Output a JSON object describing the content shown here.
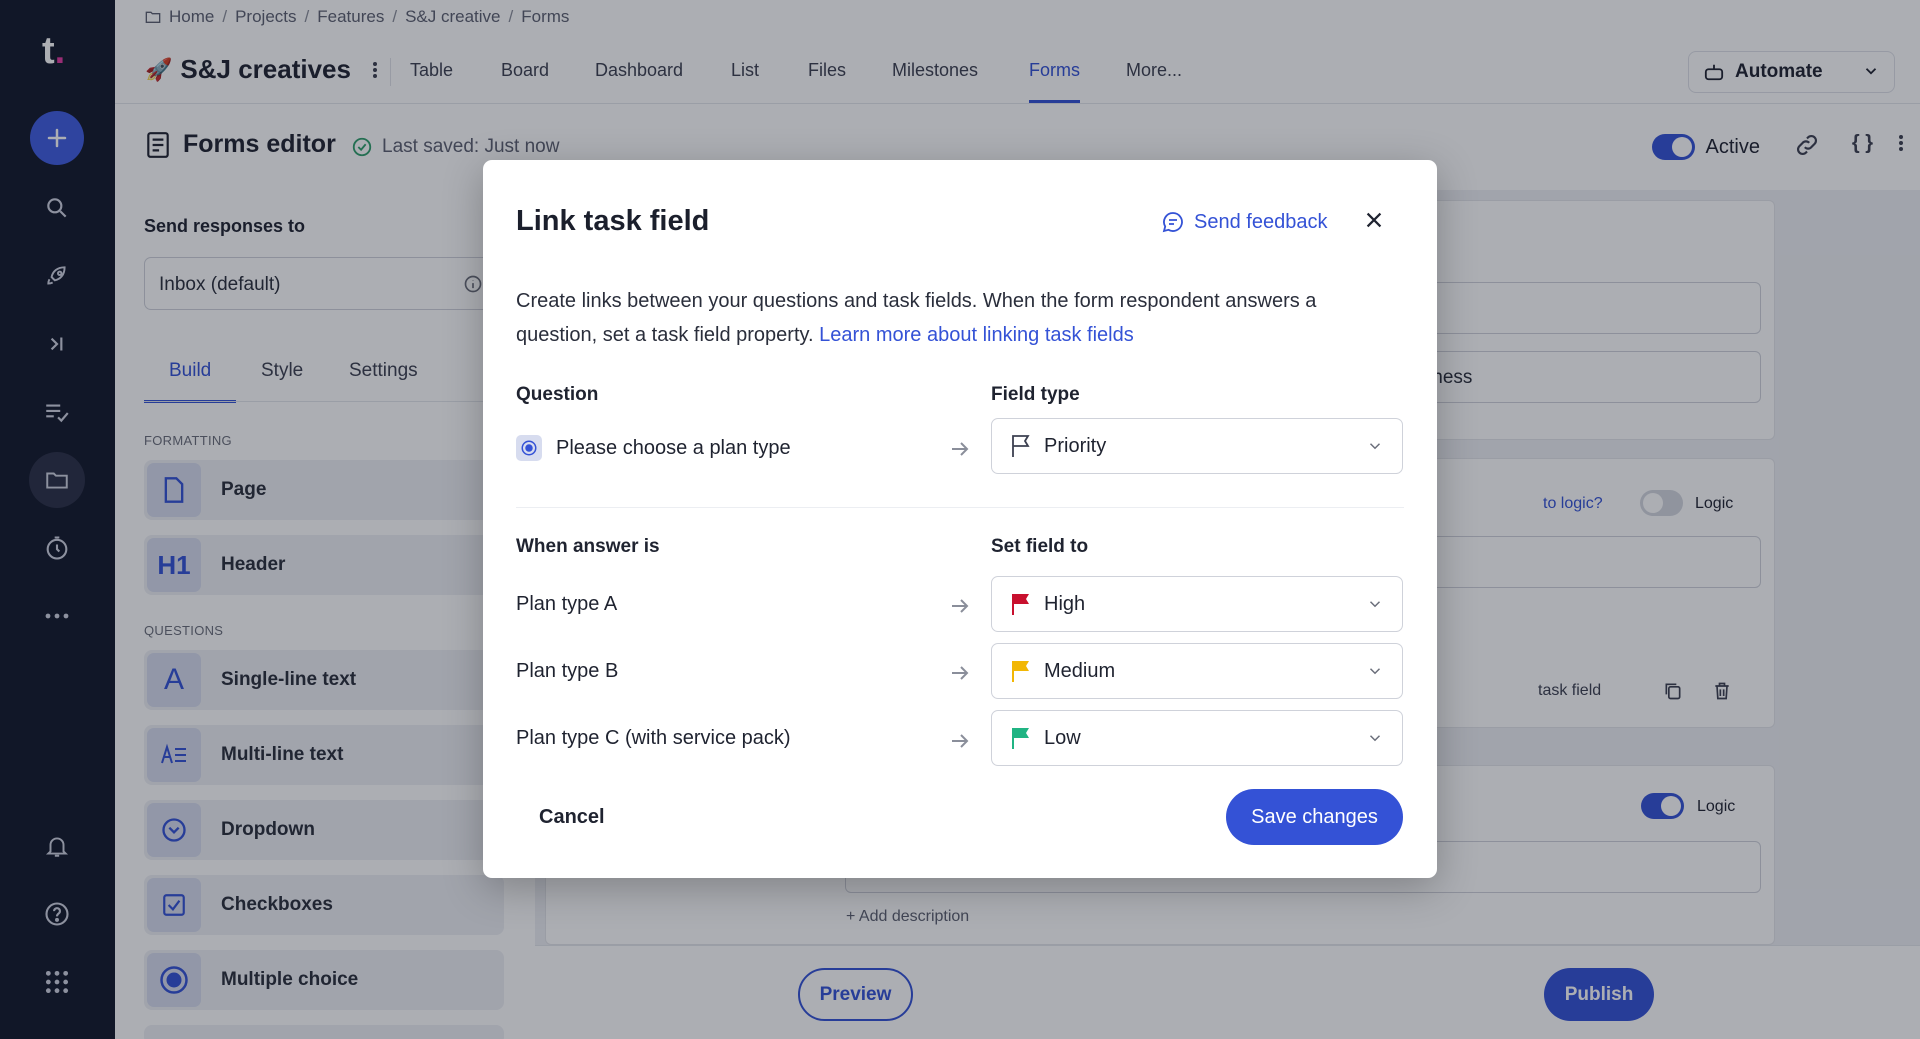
{
  "rail": {
    "logo": "t.",
    "logo_dot_color": "#e23aa0",
    "items": [
      "add-icon",
      "search-icon",
      "rocket-icon",
      "collapse-icon",
      "tasks-icon",
      "folder-icon",
      "timer-icon",
      "more-icon",
      "bell-icon",
      "help-icon",
      "apps-grid-icon"
    ]
  },
  "breadcrumb": {
    "items": [
      "Home",
      "Projects",
      "Features",
      "S&J creative",
      "Forms"
    ],
    "sep": "/"
  },
  "project": {
    "emoji": "🚀",
    "title": "S&J creatives"
  },
  "tabs": [
    "Table",
    "Board",
    "Dashboard",
    "List",
    "Files",
    "Milestones",
    "Forms",
    "More..."
  ],
  "active_tab": "Forms",
  "automate": {
    "label": "Automate"
  },
  "editor": {
    "title": "Forms editor",
    "saved": "Last saved: Just now",
    "active_label": "Active",
    "braces": "{ }"
  },
  "sidebar": {
    "send_label": "Send responses to",
    "inbox": "Inbox (default)",
    "tabs": [
      "Build",
      "Style",
      "Settings"
    ],
    "formatting_label": "FORMATTING",
    "formatting": [
      "Page",
      "Header"
    ],
    "questions_label": "QUESTIONS",
    "questions": [
      "Single-line text",
      "Multi-line text",
      "Dropdown",
      "Checkboxes",
      "Multiple choice"
    ]
  },
  "canvas": {
    "business": "usiness",
    "logic_q": "to logic?",
    "logic": "Logic",
    "task_field": "task field",
    "add_desc": "+ Add description"
  },
  "bottom": {
    "preview": "Preview",
    "publish": "Publish"
  },
  "modal": {
    "title": "Link task field",
    "feedback": "Send feedback",
    "desc_text": "Create links between your questions and task fields. When the form respondent answers a question, set a task field property. ",
    "desc_link": "Learn more about linking task fields",
    "question_header": "Question",
    "fieldtype_header": "Field type",
    "question": "Please choose a plan type",
    "field_type": "Priority",
    "answer_header": "When answer is",
    "setfield_header": "Set field to",
    "rows": [
      {
        "answer": "Plan type A",
        "value": "High",
        "color": "#c8102e"
      },
      {
        "answer": "Plan type B",
        "value": "Medium",
        "color": "#f2b705"
      },
      {
        "answer": "Plan type C (with service pack)",
        "value": "Low",
        "color": "#20b483"
      }
    ],
    "cancel": "Cancel",
    "save": "Save changes"
  },
  "colors": {
    "accent": "#3452d6",
    "rail_bg": "#12172a"
  }
}
